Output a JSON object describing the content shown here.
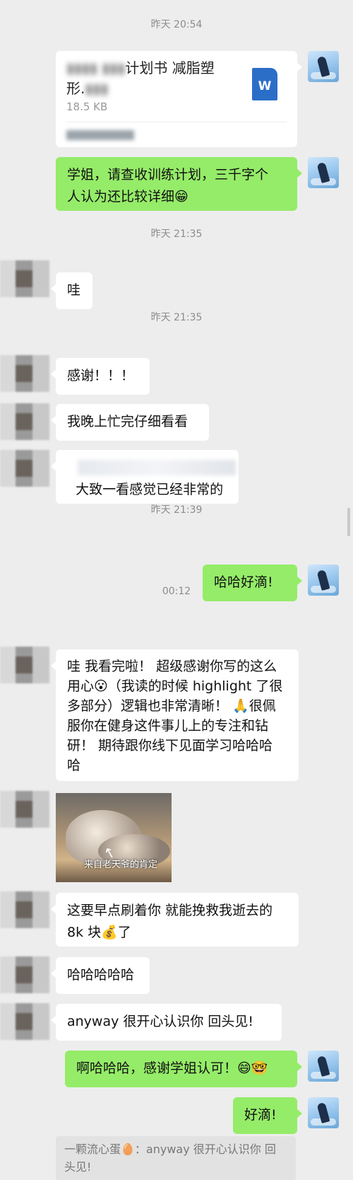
{
  "timestamps": [
    "昨天 20:54",
    "昨天 21:35",
    "昨天 21:35",
    "昨天 21:39",
    "00:12"
  ],
  "file": {
    "name_visible_1": "计划书 减脂塑",
    "name_visible_2": "形.",
    "size": "18.5 KB",
    "icon": "W"
  },
  "messages": {
    "m1": "学姐，请查收训练计划，三千字个\n人认为还比较详细😁",
    "m2": "哇",
    "m3": "感谢！！！",
    "m4": "我晚上忙完仔细看看",
    "m5": "大致一看感觉已经非常的",
    "m6": "哈哈好滴!",
    "m7": "哇 我看完啦！ 超级感谢你写的这么\n用心😮（我读的时候 highlight 了很\n多部分）逻辑也非常清晰！ 🙏很佩\n服你在健身这件事儿上的专注和钻\n研！ 期待跟你线下见面学习哈哈哈\n哈",
    "m8": "这要早点刷着你 就能挽救我逝去的\n8k 块💰了",
    "m9": "哈哈哈哈哈",
    "m10": "anyway 很开心认识你 回头见!",
    "m11": "啊哈哈哈，感谢学姐认可！😄🤓",
    "m12": "好滴!"
  },
  "photo": {
    "caption": "来自老天爷的肯定"
  },
  "quote": "一颗流心蛋🥚：anyway 很开心认识你 回\n头见!"
}
